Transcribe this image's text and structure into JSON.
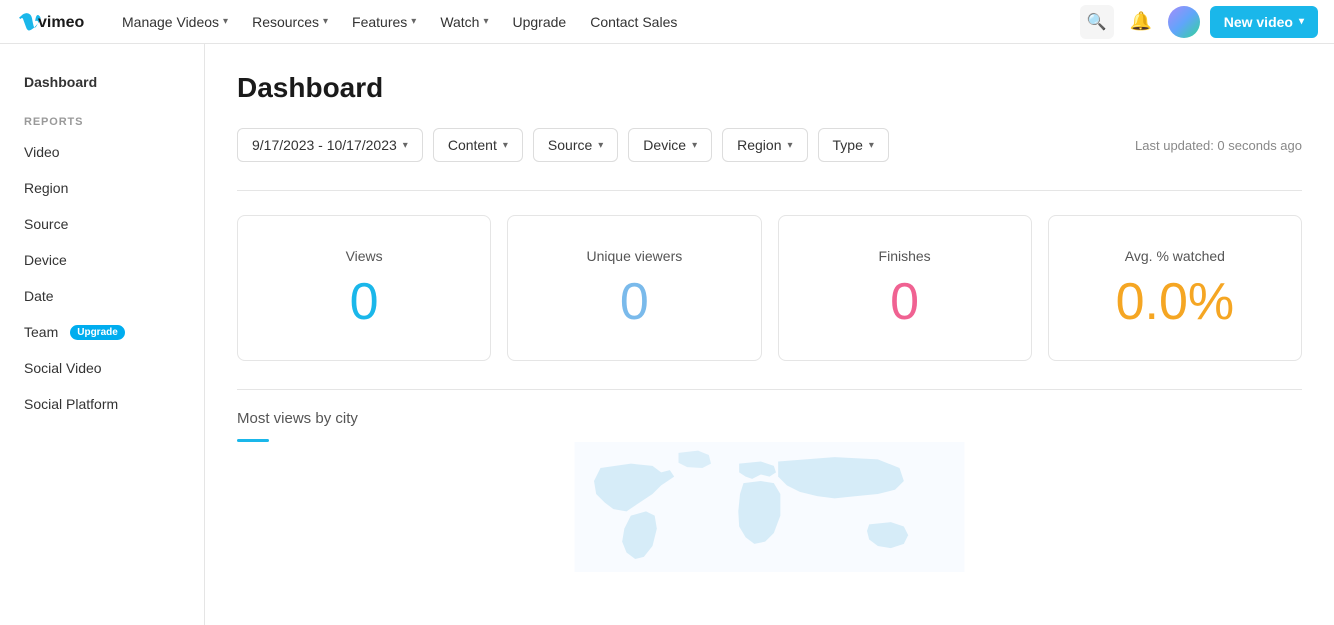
{
  "nav": {
    "logo_alt": "Vimeo",
    "items": [
      {
        "label": "Manage Videos",
        "has_dropdown": true
      },
      {
        "label": "Resources",
        "has_dropdown": true
      },
      {
        "label": "Features",
        "has_dropdown": true
      },
      {
        "label": "Watch",
        "has_dropdown": true
      },
      {
        "label": "Upgrade",
        "has_dropdown": false
      },
      {
        "label": "Contact Sales",
        "has_dropdown": false
      }
    ],
    "new_video_label": "New video"
  },
  "sidebar": {
    "top_item": "Dashboard",
    "section_label": "REPORTS",
    "items": [
      {
        "label": "Video"
      },
      {
        "label": "Region"
      },
      {
        "label": "Source"
      },
      {
        "label": "Device"
      },
      {
        "label": "Date"
      },
      {
        "label": "Team",
        "has_upgrade": true
      },
      {
        "label": "Social Video"
      },
      {
        "label": "Social Platform"
      }
    ],
    "upgrade_label": "Upgrade"
  },
  "main": {
    "page_title": "Dashboard",
    "filters": [
      {
        "label": "9/17/2023 - 10/17/2023",
        "has_dropdown": true
      },
      {
        "label": "Content",
        "has_dropdown": true
      },
      {
        "label": "Source",
        "has_dropdown": true
      },
      {
        "label": "Device",
        "has_dropdown": true
      },
      {
        "label": "Region",
        "has_dropdown": true
      },
      {
        "label": "Type",
        "has_dropdown": true
      }
    ],
    "last_updated": "Last updated: 0 seconds ago",
    "stats": [
      {
        "label": "Views",
        "value": "0",
        "color_class": "teal"
      },
      {
        "label": "Unique viewers",
        "value": "0",
        "color_class": "blue"
      },
      {
        "label": "Finishes",
        "value": "0",
        "color_class": "pink"
      },
      {
        "label": "Avg. % watched",
        "value": "0.0%",
        "color_class": "gold"
      }
    ],
    "map_title": "Most views by city"
  }
}
